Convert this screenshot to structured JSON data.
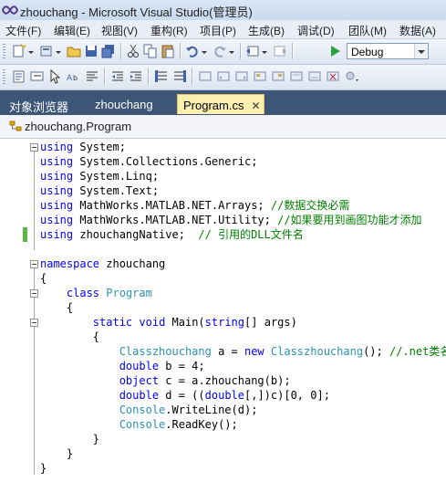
{
  "window": {
    "title": "zhouchang - Microsoft Visual Studio(管理员)"
  },
  "menu": {
    "items": [
      "文件(F)",
      "编辑(E)",
      "视图(V)",
      "重构(R)",
      "项目(P)",
      "生成(B)",
      "调试(D)",
      "团队(M)",
      "数据(A)"
    ]
  },
  "toolbar": {
    "configuration": "Debug"
  },
  "tabs": [
    {
      "label": "对象浏览器",
      "active": false
    },
    {
      "label": "zhouchang",
      "active": false
    },
    {
      "label": "Program.cs",
      "active": true,
      "close": "✕"
    }
  ],
  "navigation": {
    "type_dropdown": "zhouchang.Program"
  },
  "colors": {
    "keyword": "#0000ff",
    "type": "#2b91af",
    "comment": "#008000",
    "tab_bar": "#3d5677",
    "active_tab": "#fcf0b0",
    "change_marker": "#5cb848"
  },
  "code": {
    "lines": [
      [
        {
          "t": "using",
          "c": "kw"
        },
        {
          "t": " System;"
        }
      ],
      [
        {
          "t": "using",
          "c": "kw"
        },
        {
          "t": " System.Collections.Generic;"
        }
      ],
      [
        {
          "t": "using",
          "c": "kw"
        },
        {
          "t": " System.Linq;"
        }
      ],
      [
        {
          "t": "using",
          "c": "kw"
        },
        {
          "t": " System.Text;"
        }
      ],
      [
        {
          "t": "using",
          "c": "kw"
        },
        {
          "t": " MathWorks.MATLAB.NET.Arrays; "
        },
        {
          "t": "//数据交换必需",
          "c": "cm"
        }
      ],
      [
        {
          "t": "using",
          "c": "kw"
        },
        {
          "t": " MathWorks.MATLAB.NET.Utility; "
        },
        {
          "t": "//如果要用到画图功能才添加",
          "c": "cm"
        }
      ],
      [
        {
          "t": "using",
          "c": "kw"
        },
        {
          "t": " zhouchangNative;  "
        },
        {
          "t": "// 引用的DLL文件名",
          "c": "cm"
        }
      ],
      [],
      [
        {
          "t": "namespace",
          "c": "kw"
        },
        {
          "t": " zhouchang"
        }
      ],
      [
        {
          "t": "{"
        }
      ],
      [
        {
          "t": "    "
        },
        {
          "t": "class",
          "c": "kw"
        },
        {
          "t": " "
        },
        {
          "t": "Program",
          "c": "ty"
        }
      ],
      [
        {
          "t": "    {"
        }
      ],
      [
        {
          "t": "        "
        },
        {
          "t": "static",
          "c": "kw"
        },
        {
          "t": " "
        },
        {
          "t": "void",
          "c": "kw"
        },
        {
          "t": " Main("
        },
        {
          "t": "string",
          "c": "kw"
        },
        {
          "t": "[] args)"
        }
      ],
      [
        {
          "t": "        {"
        }
      ],
      [
        {
          "t": "            "
        },
        {
          "t": "Classzhouchang",
          "c": "ty"
        },
        {
          "t": " a = "
        },
        {
          "t": "new",
          "c": "kw"
        },
        {
          "t": " "
        },
        {
          "t": "Classzhouchang",
          "c": "ty"
        },
        {
          "t": "(); "
        },
        {
          "t": "//.net类名",
          "c": "cm"
        }
      ],
      [
        {
          "t": "            "
        },
        {
          "t": "double",
          "c": "kw"
        },
        {
          "t": " b = 4;"
        }
      ],
      [
        {
          "t": "            "
        },
        {
          "t": "object",
          "c": "kw"
        },
        {
          "t": " c = a.zhouchang(b);"
        }
      ],
      [
        {
          "t": "            "
        },
        {
          "t": "double",
          "c": "kw"
        },
        {
          "t": " d = (("
        },
        {
          "t": "double",
          "c": "kw"
        },
        {
          "t": "[,])c)[0, 0];"
        }
      ],
      [
        {
          "t": "            "
        },
        {
          "t": "Console",
          "c": "ty"
        },
        {
          "t": ".WriteLine(d);"
        }
      ],
      [
        {
          "t": "            "
        },
        {
          "t": "Console",
          "c": "ty"
        },
        {
          "t": ".ReadKey();"
        }
      ],
      [
        {
          "t": "        }"
        }
      ],
      [
        {
          "t": "    }"
        }
      ],
      [
        {
          "t": "}"
        }
      ]
    ]
  }
}
